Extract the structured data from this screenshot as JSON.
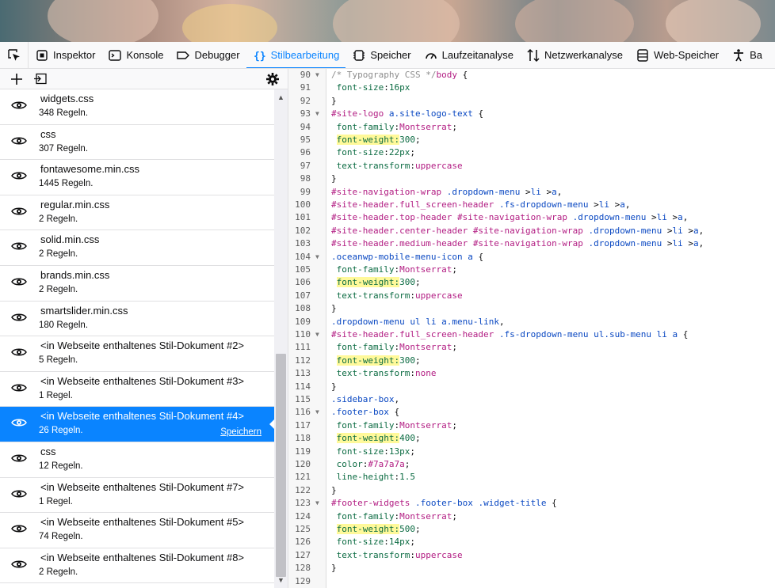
{
  "toolbar": {
    "tabs": [
      {
        "label": "Inspektor",
        "icon": "inspector-icon"
      },
      {
        "label": "Konsole",
        "icon": "console-icon"
      },
      {
        "label": "Debugger",
        "icon": "debugger-icon"
      },
      {
        "label": "Stilbearbeitung",
        "icon": "style-editor-icon",
        "active": true
      },
      {
        "label": "Speicher",
        "icon": "memory-icon"
      },
      {
        "label": "Laufzeitanalyse",
        "icon": "performance-icon"
      },
      {
        "label": "Netzwerkanalyse",
        "icon": "network-icon"
      },
      {
        "label": "Web-Speicher",
        "icon": "storage-icon"
      },
      {
        "label": "Ba",
        "icon": "accessibility-icon"
      }
    ]
  },
  "sidebar": {
    "stylesheets": [
      {
        "name": "widgets.css",
        "rules": "348 Regeln."
      },
      {
        "name": "css",
        "rules": "307 Regeln."
      },
      {
        "name": "fontawesome.min.css",
        "rules": "1445 Regeln."
      },
      {
        "name": "regular.min.css",
        "rules": "2 Regeln."
      },
      {
        "name": "solid.min.css",
        "rules": "2 Regeln."
      },
      {
        "name": "brands.min.css",
        "rules": "2 Regeln."
      },
      {
        "name": "smartslider.min.css",
        "rules": "180 Regeln."
      },
      {
        "name": "<in Webseite enthaltenes Stil-Dokument #2>",
        "rules": "5 Regeln."
      },
      {
        "name": "<in Webseite enthaltenes Stil-Dokument #3>",
        "rules": "1 Regel."
      },
      {
        "name": "<in Webseite enthaltenes Stil-Dokument #4>",
        "rules": "26 Regeln.",
        "selected": true,
        "save_label": "Speichern"
      },
      {
        "name": "css",
        "rules": "12 Regeln."
      },
      {
        "name": "<in Webseite enthaltenes Stil-Dokument #7>",
        "rules": "1 Regel."
      },
      {
        "name": "<in Webseite enthaltenes Stil-Dokument #5>",
        "rules": "74 Regeln."
      },
      {
        "name": "<in Webseite enthaltenes Stil-Dokument #8>",
        "rules": "2 Regeln."
      }
    ]
  },
  "editor": {
    "lines": [
      {
        "n": "90",
        "fold": true,
        "code": [
          [
            "t-comment",
            "/* Typography CSS */"
          ],
          [
            "t-sel",
            "body"
          ],
          [
            "t-pun",
            " {"
          ]
        ]
      },
      {
        "n": "91",
        "code": [
          [
            "t-pun",
            " "
          ],
          [
            "t-prop",
            "font-size"
          ],
          [
            "t-pun",
            ":"
          ],
          [
            "t-num",
            "16px"
          ]
        ]
      },
      {
        "n": "92",
        "code": [
          [
            "t-pun",
            "}"
          ]
        ]
      },
      {
        "n": "93",
        "fold": true,
        "code": [
          [
            "t-sel",
            "#site-logo"
          ],
          [
            "t-pun",
            " "
          ],
          [
            "t-cls",
            "a.site-logo-text"
          ],
          [
            "t-pun",
            " {"
          ]
        ]
      },
      {
        "n": "94",
        "code": [
          [
            "t-pun",
            " "
          ],
          [
            "t-prop",
            "font-family"
          ],
          [
            "t-pun",
            ":"
          ],
          [
            "t-val",
            "Montserrat"
          ],
          [
            "t-pun",
            ";"
          ]
        ]
      },
      {
        "n": "95",
        "code": [
          [
            "t-pun",
            " "
          ],
          [
            "t-prop t-hl",
            "font-weight:"
          ],
          [
            "t-num",
            "300"
          ],
          [
            "t-pun",
            ";"
          ]
        ]
      },
      {
        "n": "96",
        "code": [
          [
            "t-pun",
            " "
          ],
          [
            "t-prop",
            "font-size"
          ],
          [
            "t-pun",
            ":"
          ],
          [
            "t-num",
            "22px"
          ],
          [
            "t-pun",
            ";"
          ]
        ]
      },
      {
        "n": "97",
        "code": [
          [
            "t-pun",
            " "
          ],
          [
            "t-prop",
            "text-transform"
          ],
          [
            "t-pun",
            ":"
          ],
          [
            "t-val",
            "uppercase"
          ]
        ]
      },
      {
        "n": "98",
        "code": [
          [
            "t-pun",
            "}"
          ]
        ]
      },
      {
        "n": "99",
        "code": [
          [
            "t-sel",
            "#site-navigation-wrap"
          ],
          [
            "t-pun",
            " "
          ],
          [
            "t-cls",
            ".dropdown-menu"
          ],
          [
            "t-pun",
            " >"
          ],
          [
            "t-cls",
            "li"
          ],
          [
            "t-pun",
            " >"
          ],
          [
            "t-cls",
            "a"
          ],
          [
            "t-pun",
            ","
          ]
        ]
      },
      {
        "n": "100",
        "code": [
          [
            "t-sel",
            "#site-header.full_screen-header"
          ],
          [
            "t-pun",
            " "
          ],
          [
            "t-cls",
            ".fs-dropdown-menu"
          ],
          [
            "t-pun",
            " >"
          ],
          [
            "t-cls",
            "li"
          ],
          [
            "t-pun",
            " >"
          ],
          [
            "t-cls",
            "a"
          ],
          [
            "t-pun",
            ","
          ]
        ]
      },
      {
        "n": "101",
        "code": [
          [
            "t-sel",
            "#site-header.top-header"
          ],
          [
            "t-pun",
            " "
          ],
          [
            "t-sel",
            "#site-navigation-wrap"
          ],
          [
            "t-pun",
            " "
          ],
          [
            "t-cls",
            ".dropdown-menu"
          ],
          [
            "t-pun",
            " >"
          ],
          [
            "t-cls",
            "li"
          ],
          [
            "t-pun",
            " >"
          ],
          [
            "t-cls",
            "a"
          ],
          [
            "t-pun",
            ","
          ]
        ]
      },
      {
        "n": "102",
        "code": [
          [
            "t-sel",
            "#site-header.center-header"
          ],
          [
            "t-pun",
            " "
          ],
          [
            "t-sel",
            "#site-navigation-wrap"
          ],
          [
            "t-pun",
            " "
          ],
          [
            "t-cls",
            ".dropdown-menu"
          ],
          [
            "t-pun",
            " >"
          ],
          [
            "t-cls",
            "li"
          ],
          [
            "t-pun",
            " >"
          ],
          [
            "t-cls",
            "a"
          ],
          [
            "t-pun",
            ","
          ]
        ]
      },
      {
        "n": "103",
        "code": [
          [
            "t-sel",
            "#site-header.medium-header"
          ],
          [
            "t-pun",
            " "
          ],
          [
            "t-sel",
            "#site-navigation-wrap"
          ],
          [
            "t-pun",
            " "
          ],
          [
            "t-cls",
            ".dropdown-menu"
          ],
          [
            "t-pun",
            " >"
          ],
          [
            "t-cls",
            "li"
          ],
          [
            "t-pun",
            " >"
          ],
          [
            "t-cls",
            "a"
          ],
          [
            "t-pun",
            ","
          ]
        ]
      },
      {
        "n": "104",
        "fold": true,
        "code": [
          [
            "t-cls",
            ".oceanwp-mobile-menu-icon"
          ],
          [
            "t-pun",
            " "
          ],
          [
            "t-cls",
            "a"
          ],
          [
            "t-pun",
            " {"
          ]
        ]
      },
      {
        "n": "105",
        "code": [
          [
            "t-pun",
            " "
          ],
          [
            "t-prop",
            "font-family"
          ],
          [
            "t-pun",
            ":"
          ],
          [
            "t-val",
            "Montserrat"
          ],
          [
            "t-pun",
            ";"
          ]
        ]
      },
      {
        "n": "106",
        "code": [
          [
            "t-pun",
            " "
          ],
          [
            "t-prop t-hl",
            "font-weight:"
          ],
          [
            "t-num",
            "300"
          ],
          [
            "t-pun",
            ";"
          ]
        ]
      },
      {
        "n": "107",
        "code": [
          [
            "t-pun",
            " "
          ],
          [
            "t-prop",
            "text-transform"
          ],
          [
            "t-pun",
            ":"
          ],
          [
            "t-val",
            "uppercase"
          ]
        ]
      },
      {
        "n": "108",
        "code": [
          [
            "t-pun",
            "}"
          ]
        ]
      },
      {
        "n": "109",
        "code": [
          [
            "t-cls",
            ".dropdown-menu"
          ],
          [
            "t-pun",
            " "
          ],
          [
            "t-cls",
            "ul"
          ],
          [
            "t-pun",
            " "
          ],
          [
            "t-cls",
            "li"
          ],
          [
            "t-pun",
            " "
          ],
          [
            "t-cls",
            "a.menu-link"
          ],
          [
            "t-pun",
            ","
          ]
        ]
      },
      {
        "n": "110",
        "fold": true,
        "code": [
          [
            "t-sel",
            "#site-header.full_screen-header"
          ],
          [
            "t-pun",
            " "
          ],
          [
            "t-cls",
            ".fs-dropdown-menu"
          ],
          [
            "t-pun",
            " "
          ],
          [
            "t-cls",
            "ul.sub-menu"
          ],
          [
            "t-pun",
            " "
          ],
          [
            "t-cls",
            "li"
          ],
          [
            "t-pun",
            " "
          ],
          [
            "t-cls",
            "a"
          ],
          [
            "t-pun",
            " {"
          ]
        ]
      },
      {
        "n": "111",
        "code": [
          [
            "t-pun",
            " "
          ],
          [
            "t-prop",
            "font-family"
          ],
          [
            "t-pun",
            ":"
          ],
          [
            "t-val",
            "Montserrat"
          ],
          [
            "t-pun",
            ";"
          ]
        ]
      },
      {
        "n": "112",
        "code": [
          [
            "t-pun",
            " "
          ],
          [
            "t-prop t-hl",
            "font-weight:"
          ],
          [
            "t-num",
            "300"
          ],
          [
            "t-pun",
            ";"
          ]
        ]
      },
      {
        "n": "113",
        "code": [
          [
            "t-pun",
            " "
          ],
          [
            "t-prop",
            "text-transform"
          ],
          [
            "t-pun",
            ":"
          ],
          [
            "t-val",
            "none"
          ]
        ]
      },
      {
        "n": "114",
        "code": [
          [
            "t-pun",
            "}"
          ]
        ]
      },
      {
        "n": "115",
        "code": [
          [
            "t-cls",
            ".sidebar-box"
          ],
          [
            "t-pun",
            ","
          ]
        ]
      },
      {
        "n": "116",
        "fold": true,
        "code": [
          [
            "t-cls",
            ".footer-box"
          ],
          [
            "t-pun",
            " {"
          ]
        ]
      },
      {
        "n": "117",
        "code": [
          [
            "t-pun",
            " "
          ],
          [
            "t-prop",
            "font-family"
          ],
          [
            "t-pun",
            ":"
          ],
          [
            "t-val",
            "Montserrat"
          ],
          [
            "t-pun",
            ";"
          ]
        ]
      },
      {
        "n": "118",
        "code": [
          [
            "t-pun",
            " "
          ],
          [
            "t-prop t-hl",
            "font-weight:"
          ],
          [
            "t-num",
            "400"
          ],
          [
            "t-pun",
            ";"
          ]
        ]
      },
      {
        "n": "119",
        "code": [
          [
            "t-pun",
            " "
          ],
          [
            "t-prop",
            "font-size"
          ],
          [
            "t-pun",
            ":"
          ],
          [
            "t-num",
            "13px"
          ],
          [
            "t-pun",
            ";"
          ]
        ]
      },
      {
        "n": "120",
        "code": [
          [
            "t-pun",
            " "
          ],
          [
            "t-prop",
            "color"
          ],
          [
            "t-pun",
            ":"
          ],
          [
            "t-val",
            "#7a7a7a"
          ],
          [
            "t-pun",
            ";"
          ]
        ]
      },
      {
        "n": "121",
        "code": [
          [
            "t-pun",
            " "
          ],
          [
            "t-prop",
            "line-height"
          ],
          [
            "t-pun",
            ":"
          ],
          [
            "t-num",
            "1.5"
          ]
        ]
      },
      {
        "n": "122",
        "code": [
          [
            "t-pun",
            "}"
          ]
        ]
      },
      {
        "n": "123",
        "fold": true,
        "code": [
          [
            "t-sel",
            "#footer-widgets"
          ],
          [
            "t-pun",
            " "
          ],
          [
            "t-cls",
            ".footer-box"
          ],
          [
            "t-pun",
            " "
          ],
          [
            "t-cls",
            ".widget-title"
          ],
          [
            "t-pun",
            " {"
          ]
        ]
      },
      {
        "n": "124",
        "code": [
          [
            "t-pun",
            " "
          ],
          [
            "t-prop",
            "font-family"
          ],
          [
            "t-pun",
            ":"
          ],
          [
            "t-val",
            "Montserrat"
          ],
          [
            "t-pun",
            ";"
          ]
        ]
      },
      {
        "n": "125",
        "code": [
          [
            "t-pun",
            " "
          ],
          [
            "t-prop t-hl",
            "font-weight:"
          ],
          [
            "t-num",
            "500"
          ],
          [
            "t-pun",
            ";"
          ]
        ]
      },
      {
        "n": "126",
        "code": [
          [
            "t-pun",
            " "
          ],
          [
            "t-prop",
            "font-size"
          ],
          [
            "t-pun",
            ":"
          ],
          [
            "t-num",
            "14px"
          ],
          [
            "t-pun",
            ";"
          ]
        ]
      },
      {
        "n": "127",
        "code": [
          [
            "t-pun",
            " "
          ],
          [
            "t-prop",
            "text-transform"
          ],
          [
            "t-pun",
            ":"
          ],
          [
            "t-val",
            "uppercase"
          ]
        ]
      },
      {
        "n": "128",
        "code": [
          [
            "t-pun",
            "}"
          ]
        ]
      },
      {
        "n": "129",
        "code": []
      }
    ]
  },
  "colors": {
    "accent": "#0a84ff",
    "highlight": "#fff99a",
    "selector": "#b21c82",
    "class": "#0a48c2",
    "property": "#0b6b42"
  }
}
